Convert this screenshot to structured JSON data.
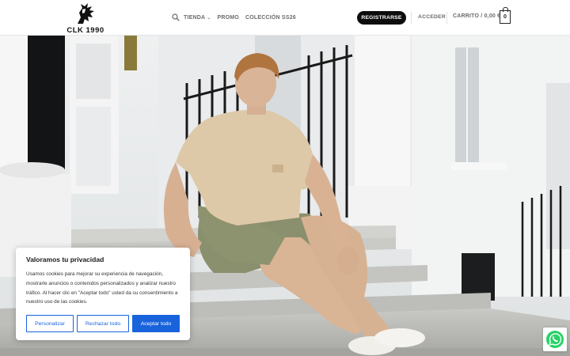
{
  "header": {
    "logo_text": "CLK 1990",
    "nav": [
      {
        "label": "TIENDA",
        "has_dropdown": true
      },
      {
        "label": "PROMO",
        "has_dropdown": false
      },
      {
        "label": "COLECCIÓN SS26",
        "has_dropdown": false
      }
    ],
    "register_label": "REGISTRARSE",
    "login_label": "ACCEDER",
    "cart_label": "CARRITO / 0,00 €",
    "cart_count": "0",
    "icons": {
      "search": "search-icon",
      "cart": "cart-icon",
      "chevron": "chevron-down-icon"
    }
  },
  "hero": {
    "image": "man-in-beige-tshirt-sitting-on-steps"
  },
  "cookie_banner": {
    "title": "Valoramos tu privacidad",
    "text": "Usamos cookies para mejorar su experiencia de navegación, mostrarle anuncios o contenidos personalizados y analizar nuestro tráfico. Al hacer clic en \"Aceptar todo\" usted da su consentimiento a nuestro uso de las cookies.",
    "buttons": {
      "customize": "Personalizar",
      "reject": "Rechazar todo",
      "accept": "Aceptar todo"
    },
    "accent": "#1863dc"
  },
  "whatsapp": {
    "icon": "whatsapp-icon",
    "color": "#25d366"
  }
}
